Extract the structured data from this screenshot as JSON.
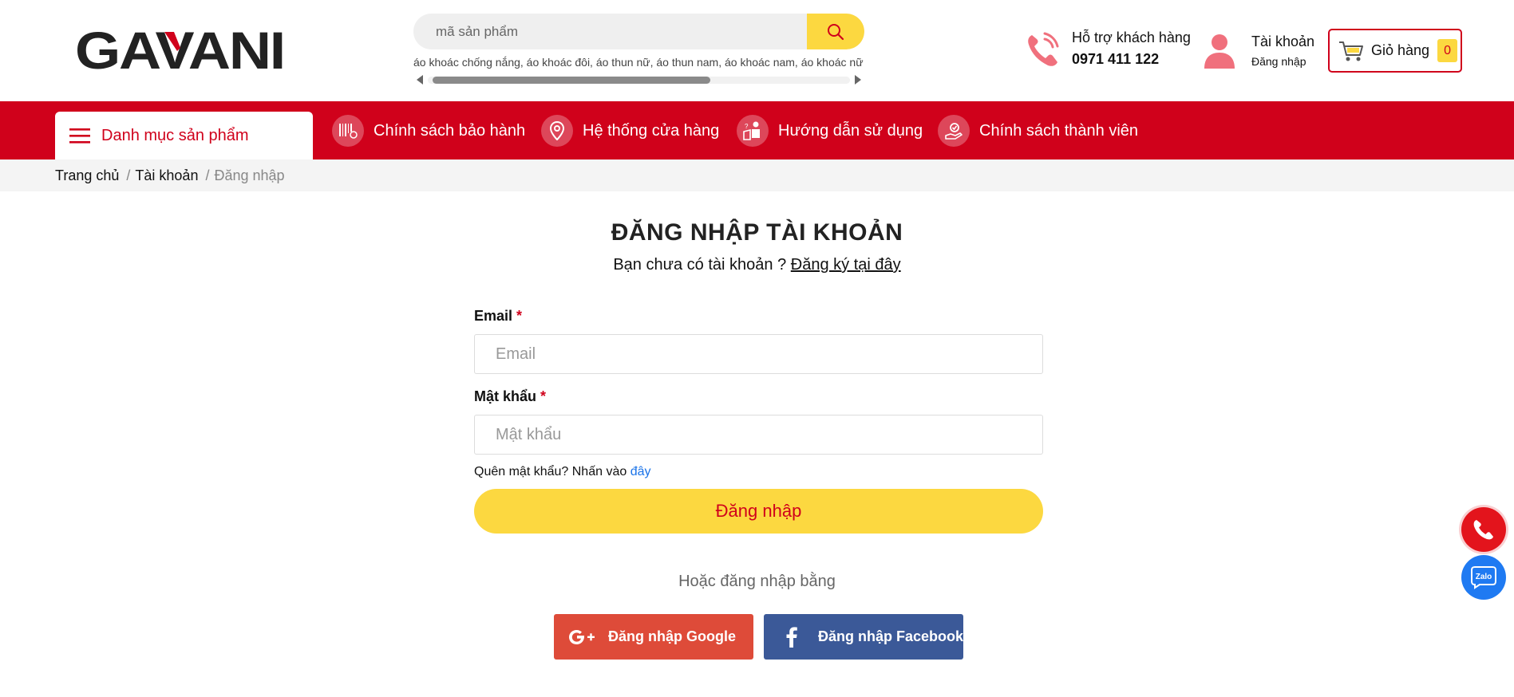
{
  "header": {
    "logo_text": "GAVANI",
    "search": {
      "placeholder": "mã sản phẩm",
      "tags": "áo khoác chống nắng, áo khoác đôi, áo thun nữ, áo thun nam, áo khoác nam, áo khoác nữ"
    },
    "support": {
      "label": "Hỗ trợ khách hàng",
      "phone": "0971 411 122"
    },
    "account": {
      "label": "Tài khoản",
      "sub": "Đăng nhập"
    },
    "cart": {
      "label": "Giỏ hàng",
      "count": "0"
    }
  },
  "nav": {
    "category_label": "Danh mục sản phẩm",
    "items": [
      {
        "label": "Chính sách bảo hành",
        "icon": "barcode-icon"
      },
      {
        "label": "Hệ thống cửa hàng",
        "icon": "location-pin-icon"
      },
      {
        "label": "Hướng dẫn sử dụng",
        "icon": "guide-icon"
      },
      {
        "label": "Chính sách thành viên",
        "icon": "member-icon"
      }
    ]
  },
  "breadcrumb": {
    "home": "Trang chủ",
    "sep": "/",
    "account": "Tài khoản",
    "current": "Đăng nhập"
  },
  "login": {
    "title": "ĐĂNG NHẬP TÀI KHOẢN",
    "sub_text": "Bạn chưa có tài khoản ?",
    "register_link": "Đăng ký tại đây",
    "email_label": "Email",
    "email_placeholder": "Email",
    "password_label": "Mật khẩu",
    "password_placeholder": "Mật khẩu",
    "required_mark": "*",
    "forgot_text": "Quên mật khẩu? Nhấn vào",
    "forgot_link": "đây",
    "submit_label": "Đăng nhập",
    "or_text": "Hoặc đăng nhập bằng",
    "google_label": "Đăng nhập Google",
    "facebook_label": "Đăng nhập Facebook"
  },
  "floating": {
    "zalo_label": "Zalo"
  },
  "colors": {
    "brand_red": "#d0011b",
    "accent_yellow": "#fcd840",
    "google": "#de4b39",
    "facebook": "#3b5998",
    "zalo": "#1f7af2"
  }
}
